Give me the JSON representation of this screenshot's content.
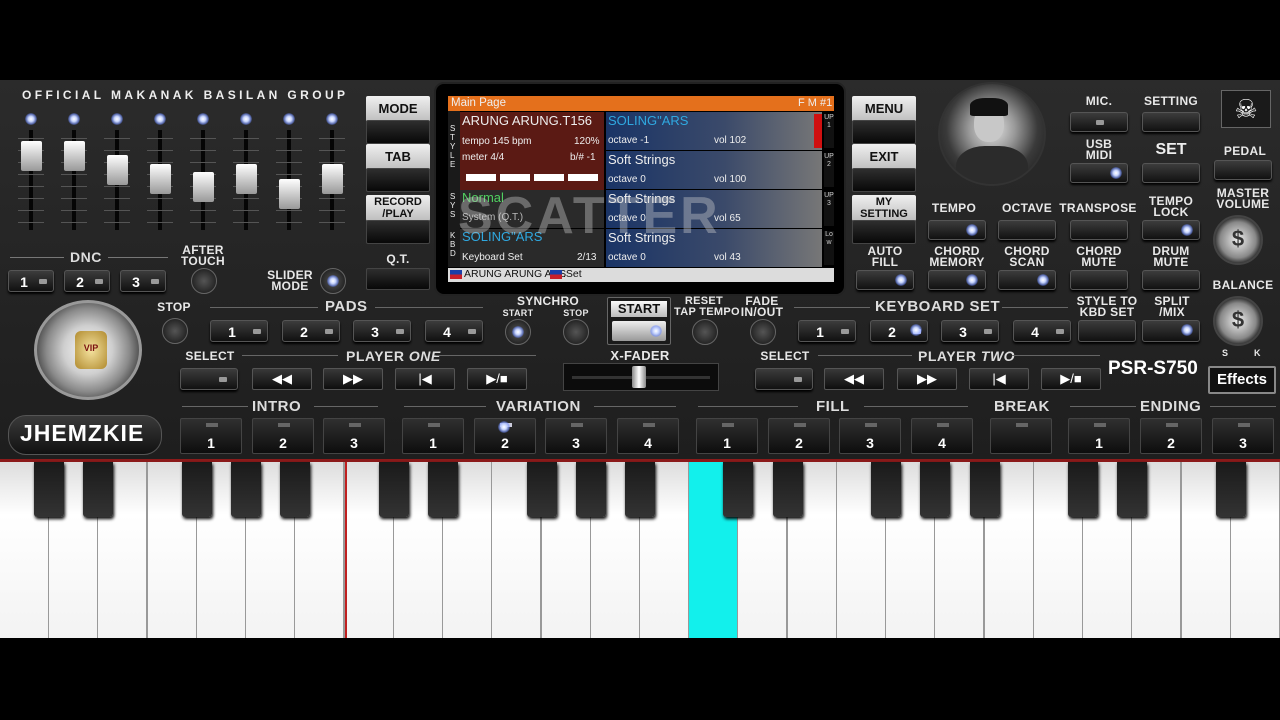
{
  "brand_top": "OFFICIAL MAKANAK BASILAN GROUP",
  "username": "JHEMZKIE",
  "model": "PSR-S750",
  "effects_label": "Effects",
  "emblem_text": "VIP",
  "left_menu": [
    "MODE",
    "TAB",
    "RECORD\n/PLAY",
    "Q.T."
  ],
  "right_menu": [
    "MENU",
    "EXIT",
    "MY\nSETTING"
  ],
  "dnc": {
    "label": "DNC",
    "buttons": [
      "1",
      "2",
      "3"
    ],
    "after_touch": "AFTER\nTOUCH",
    "slider_mode": "SLIDER\nMODE"
  },
  "sliders": [
    0.85,
    0.85,
    0.65,
    0.52,
    0.4,
    0.52,
    0.3,
    0.52
  ],
  "pads": {
    "label": "PADS",
    "stop": "STOP",
    "buttons": [
      "1",
      "2",
      "3",
      "4"
    ]
  },
  "synchro": {
    "label": "SYNCHRO",
    "start": "START",
    "stop": "STOP"
  },
  "start_label": "START",
  "reset_label": "RESET\nTAP TEMPO",
  "fade_label": "FADE\nIN/OUT",
  "xfader_label": "X-FADER",
  "player_one": {
    "select": "SELECT",
    "label": "PLAYER",
    "label_em": "ONE"
  },
  "player_two": {
    "select": "SELECT",
    "label": "PLAYER",
    "label_em": "TWO"
  },
  "keyboard_set": {
    "label": "KEYBOARD SET",
    "buttons": [
      "1",
      "2",
      "3",
      "4"
    ],
    "style_to": "STYLE TO\nKBD SET",
    "split": "SPLIT\n/MIX"
  },
  "transport_symbols": [
    "◀◀",
    "▶▶",
    "|◀",
    "▶/■"
  ],
  "sections": {
    "intro": {
      "label": "INTRO",
      "buttons": [
        "1",
        "2",
        "3"
      ]
    },
    "variation": {
      "label": "VARIATION",
      "buttons": [
        "1",
        "2",
        "3",
        "4"
      ]
    },
    "fill": {
      "label": "FILL",
      "buttons": [
        "1",
        "2",
        "3",
        "4"
      ]
    },
    "break": {
      "label": "BREAK"
    },
    "ending": {
      "label": "ENDING",
      "buttons": [
        "1",
        "2",
        "3"
      ]
    }
  },
  "right_controls": {
    "mic": "MIC.",
    "setting": "SETTING",
    "usb_midi": "USB\nMIDI",
    "set": "SET",
    "pedal": "PEDAL",
    "master_volume": "MASTER\nVOLUME",
    "tempo": "TEMPO",
    "octave": "OCTAVE",
    "transpose": "TRANSPOSE",
    "tempo_lock": "TEMPO\nLOCK",
    "balance": "BALANCE",
    "balance_s": "S",
    "balance_k": "K",
    "auto_fill": "AUTO\nFILL",
    "chord_memory": "CHORD\nMEMORY",
    "chord_scan": "CHORD\nSCAN",
    "chord_mute": "CHORD\nMUTE",
    "drum_mute": "DRUM\nMUTE"
  },
  "screen": {
    "header_title": "Main Page",
    "header_right": "F M #1",
    "watermark": "SCATTER",
    "style_name": "ARUNG ARUNG.T156",
    "tempo": "tempo 145 bpm",
    "tempo_pct": "120%",
    "meter": "meter 4/4",
    "key": "b/# -1",
    "sys_name": "Normal",
    "sys_sub": "System (Q.T.)",
    "kbd_name": "SOLING\"ARS",
    "kbd_sub": "Keyboard Set",
    "kbd_page": "2/13",
    "side_style": "STYLE",
    "side_sys": "SYS",
    "side_kbd": "KBD",
    "voices": [
      {
        "name": "SOLING\"ARS",
        "octave": "octave -1",
        "vol": "vol 102",
        "tag": "UP1"
      },
      {
        "name": "Soft Strings",
        "octave": "octave 0",
        "vol": "vol 100",
        "tag": "UP2"
      },
      {
        "name": "Soft Strings",
        "octave": "octave 0",
        "vol": "vol 65",
        "tag": "UP3"
      },
      {
        "name": "Soft Strings",
        "octave": "octave 0",
        "vol": "vol 43",
        "tag": "Low"
      }
    ],
    "footer": "ARUNG ARUNG ARS",
    "footer_set": ".Set"
  },
  "keyboard": {
    "white_keys": 26,
    "highlighted_white": 14,
    "highlight_color": "#12f0ec"
  }
}
